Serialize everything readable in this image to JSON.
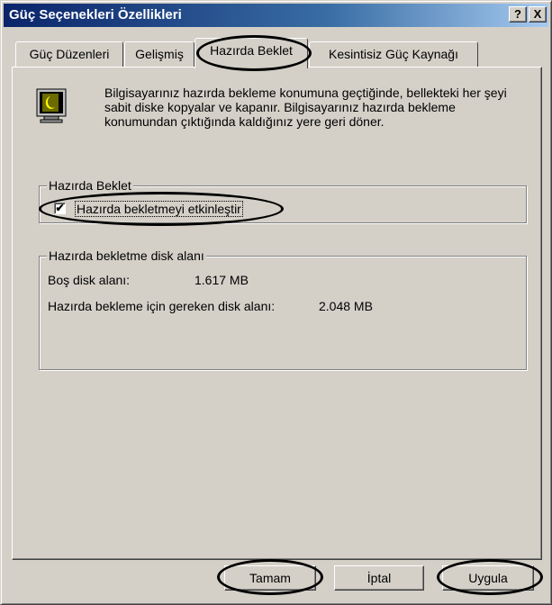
{
  "window": {
    "title": "Güç Seçenekleri Özellikleri",
    "help_label": "?",
    "close_label": "X"
  },
  "tabs": [
    {
      "label": "Güç Düzenleri",
      "active": false
    },
    {
      "label": "Gelişmiş",
      "active": false
    },
    {
      "label": "Hazırda Beklet",
      "active": true
    },
    {
      "label": "Kesintisiz Güç Kaynağı",
      "active": false
    }
  ],
  "description": "Bilgisayarınız hazırda bekleme konumuna geçtiğinde, bellekteki her şeyi sabit diske kopyalar ve kapanır. Bilgisayarınız hazırda bekleme konumundan çıktığında kaldığınız yere geri döner.",
  "hibernate_group": {
    "title": "Hazırda Beklet",
    "checkbox_label": "Hazırda bekletmeyi etkinleştir",
    "checked": true,
    "check_mark": "✔"
  },
  "disk_group": {
    "title": "Hazırda bekletme disk alanı",
    "free_label": "Boş disk alanı:",
    "free_value": "1.617 MB",
    "required_label": "Hazırda bekleme için gereken disk alanı:",
    "required_value": "2.048 MB"
  },
  "buttons": {
    "ok": "Tamam",
    "cancel": "İptal",
    "apply": "Uygula"
  },
  "colors": {
    "title_start": "#0a246a",
    "title_end": "#a6caf0",
    "face": "#d4d0c8"
  }
}
